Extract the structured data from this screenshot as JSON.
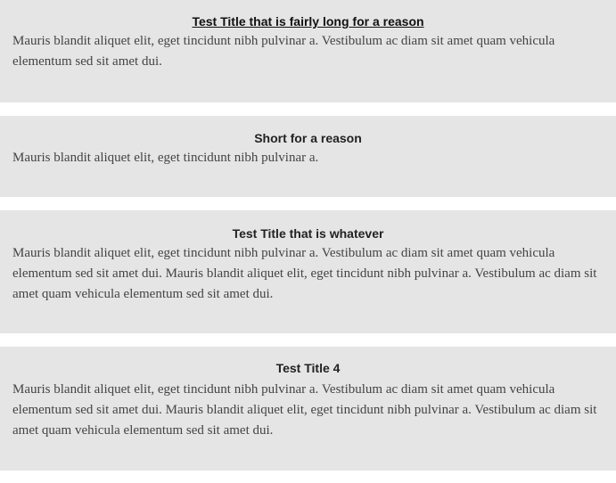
{
  "cards": [
    {
      "title": "Test Title that is fairly long for a reason",
      "title_is_link": true,
      "body": "Mauris blandit aliquet elit, eget tincidunt nibh pulvinar a. Vestibulum ac diam sit amet quam vehicula elementum sed sit amet dui."
    },
    {
      "title": "Short for a reason",
      "title_is_link": false,
      "body": "Mauris blandit aliquet elit, eget tincidunt nibh pulvinar a."
    },
    {
      "title": "Test Title that is whatever",
      "title_is_link": false,
      "body": "Mauris blandit aliquet elit, eget tincidunt nibh pulvinar a. Vestibulum ac diam sit amet quam vehicula elementum sed sit amet dui. Mauris blandit aliquet elit, eget tincidunt nibh pulvinar a. Vestibulum ac diam sit amet quam vehicula elementum sed sit amet dui."
    },
    {
      "title": "Test Title 4",
      "title_is_link": false,
      "body": "Mauris blandit aliquet elit, eget tincidunt nibh pulvinar a. Vestibulum ac diam sit amet quam vehicula elementum sed sit amet dui. Mauris blandit aliquet elit, eget tincidunt nibh pulvinar a. Vestibulum ac diam sit amet quam vehicula elementum sed sit amet dui."
    }
  ],
  "colors": {
    "card_background": "#e5e5e5",
    "page_background": "#ffffff",
    "title_text": "#222222",
    "body_text": "#444444"
  }
}
